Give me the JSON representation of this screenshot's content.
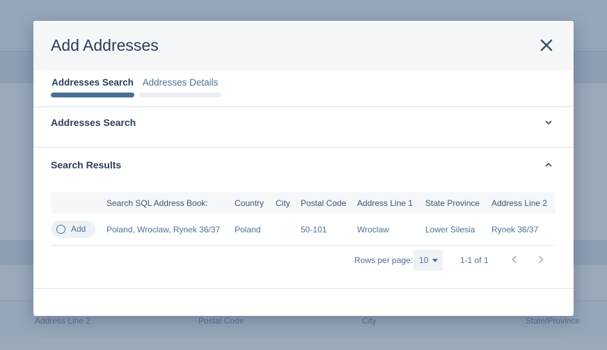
{
  "background": {
    "footer_labels": [
      "Address Line 2",
      "Postal Code",
      "City",
      "State/Province"
    ]
  },
  "modal": {
    "title": "Add Addresses",
    "close_icon": "close-icon",
    "tabs": [
      {
        "label": "Addresses Search",
        "active": true
      },
      {
        "label": "Addresses Details",
        "active": false
      }
    ],
    "search_section": {
      "title": "Addresses Search",
      "icon": "chevron-down-icon"
    },
    "results_section": {
      "title": "Search Results",
      "icon": "chevron-up-icon",
      "columns": [
        "",
        "Search SQL Address Book:",
        "Country",
        "City",
        "Postal Code",
        "Address Line 1",
        "State Province",
        "Address Line 2"
      ],
      "rows": [
        {
          "action": "Add",
          "search": "Poland, Wroclaw, Rynek 36/37",
          "country": "Poland",
          "city": "",
          "postal_code": "50-101",
          "address_line_1": "Wroclaw",
          "state_province": "Lower Silesia",
          "address_line_2": "Rynek 36/37"
        }
      ],
      "pagination": {
        "rows_per_page_label": "Rows per page:",
        "rows_per_page": "10",
        "range": "1-1 of 1"
      }
    }
  },
  "colors": {
    "title": "#2b3e58",
    "accent": "#4a6f97",
    "link_text": "#4f6f98",
    "overlay": "#9aa8ba"
  }
}
